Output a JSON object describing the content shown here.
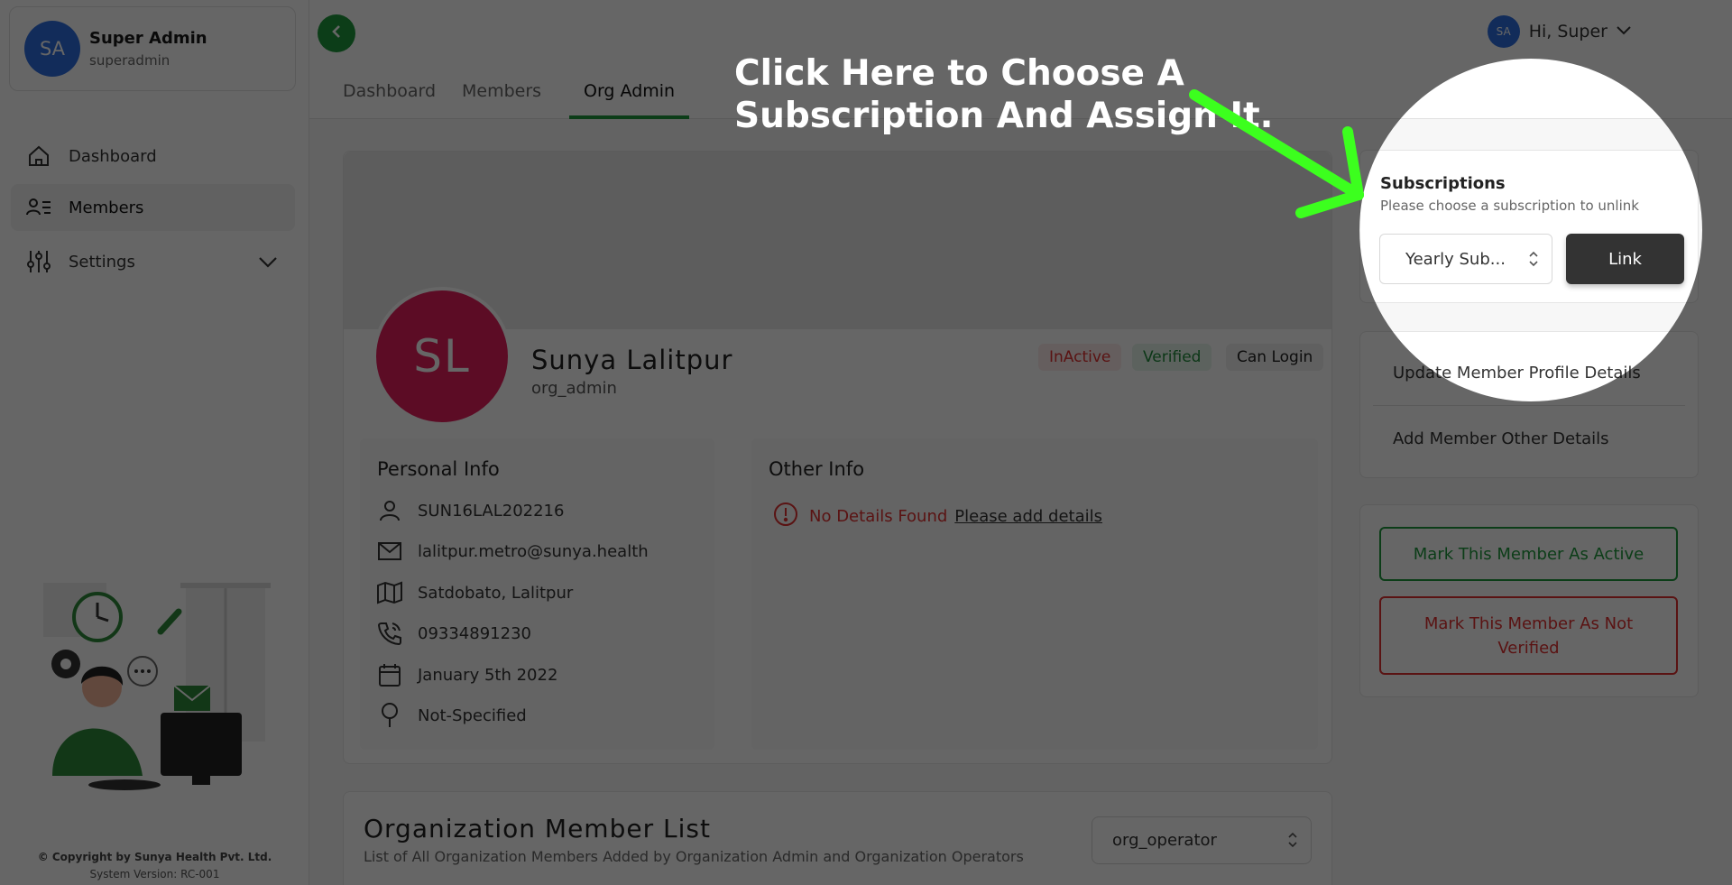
{
  "sidebar": {
    "profile": {
      "initials": "SA",
      "name": "Super Admin",
      "username": "superadmin"
    },
    "items": [
      {
        "label": "Dashboard",
        "icon": "home-icon"
      },
      {
        "label": "Members",
        "icon": "members-icon"
      },
      {
        "label": "Settings",
        "icon": "sliders-icon"
      }
    ],
    "copyright": "© Copyright by Sunya Health Pvt. Ltd.",
    "version": "System Version: RC-001"
  },
  "header": {
    "back_icon": "chevron-left-icon",
    "user_initials": "SA",
    "greeting": "Hi, Super"
  },
  "tabs": [
    {
      "label": "Dashboard"
    },
    {
      "label": "Members"
    },
    {
      "label": "Org Admin"
    }
  ],
  "member": {
    "initials": "SL",
    "name": "Sunya Lalitpur",
    "role": "org_admin",
    "badges": {
      "status": "InActive",
      "verification": "Verified",
      "login": "Can Login"
    },
    "personal_info": {
      "title": "Personal Info",
      "id": "SUN16LAL202216",
      "email": "lalitpur.metro@sunya.health",
      "address": "Satdobato, Lalitpur",
      "phone": "09334891230",
      "date": "January 5th 2022",
      "gender": "Not-Specified"
    },
    "other_info": {
      "title": "Other Info",
      "empty_text": "No Details Found",
      "add_link": "Please add details"
    }
  },
  "member_list": {
    "title": "Organization Member List",
    "subtitle": "List of All Organization Members Added by Organization Admin and Organization Operators",
    "filter_value": "org_operator"
  },
  "subscriptions": {
    "title": "Subscriptions",
    "description": "Please choose a subscription to unlink",
    "selected": "Yearly Sub...",
    "link_label": "Link"
  },
  "actions": {
    "update_profile": "Update Member Profile Details",
    "add_other": "Add Member Other Details"
  },
  "status_actions": {
    "mark_active": "Mark This Member As Active",
    "mark_not_verified": "Mark This Member As Not Verified"
  },
  "tutorial": {
    "line1": "Click Here to Choose A",
    "line2": "Subscription And Assign It."
  },
  "colors": {
    "accent_green": "#1f9a3e",
    "danger_red": "#e03030",
    "avatar_blue": "#2f6fe0",
    "member_avatar": "#e5205e",
    "arrow_green": "#3cff1e"
  }
}
